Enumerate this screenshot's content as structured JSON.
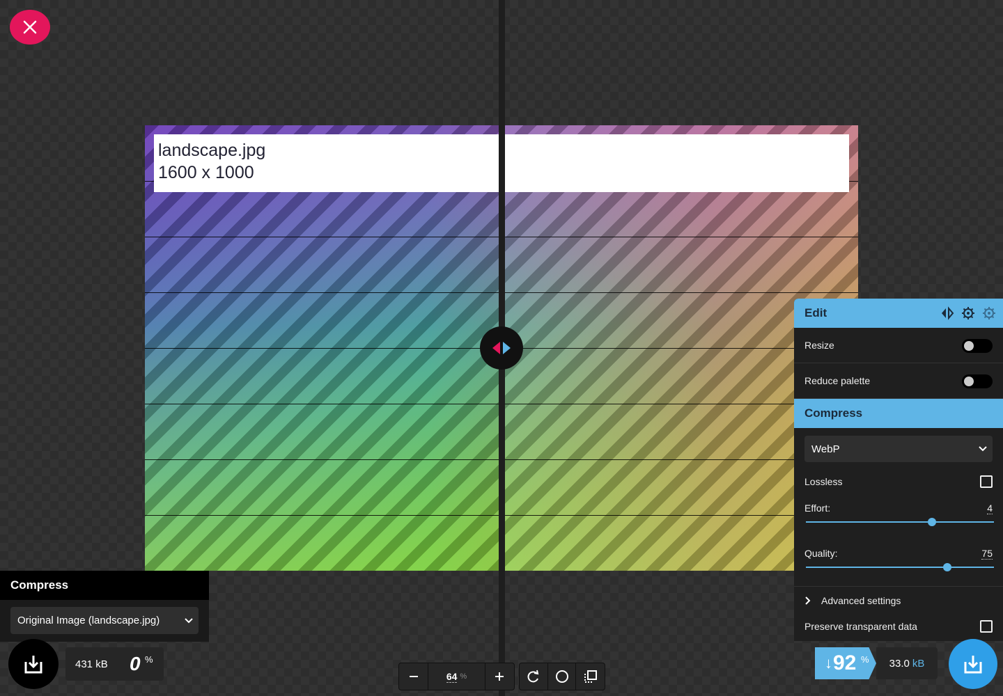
{
  "image": {
    "filename": "landscape.jpg",
    "dimensions": "1600 x 1000"
  },
  "left_panel": {
    "title": "Compress",
    "select_value": "Original Image (landscape.jpg)"
  },
  "left_stats": {
    "size": "431 kB",
    "percent": "0",
    "percent_sign": "%"
  },
  "toolbar": {
    "zoom_value": "64",
    "zoom_unit": "%",
    "icons": [
      "minus-icon",
      "plus-icon",
      "rotate-icon",
      "background-toggle-icon",
      "crop-icon"
    ]
  },
  "edit_panel": {
    "title": "Edit",
    "icons": [
      "swap-sides-icon",
      "copy-settings-icon",
      "import-settings-icon"
    ],
    "resize_label": "Resize",
    "resize_on": false,
    "reduce_palette_label": "Reduce palette",
    "reduce_palette_on": false,
    "compress_title": "Compress",
    "format_value": "WebP",
    "lossless_label": "Lossless",
    "lossless_checked": false,
    "effort_label": "Effort:",
    "effort_value": "4",
    "effort_fraction": 0.67,
    "quality_label": "Quality:",
    "quality_value": "75",
    "quality_fraction": 0.75,
    "advanced_label": "Advanced settings",
    "preserve_label": "Preserve transparent data",
    "preserve_checked": false
  },
  "right_stats": {
    "arrow": "↓",
    "savings": "92",
    "savings_sign": "%",
    "size_value": "33.0",
    "size_unit": "kB"
  },
  "colors": {
    "accent_blue": "#5fb5e6",
    "close_pink": "#e3165b",
    "download_blue": "#2f9fe8"
  }
}
